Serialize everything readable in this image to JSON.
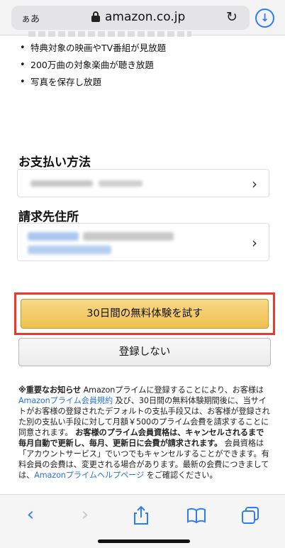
{
  "browser": {
    "aa_label": "ぁあ",
    "domain": "amazon.co.jp",
    "reload_icon": "reload-icon",
    "download_icon": "download-icon"
  },
  "benefits": [
    "特典対象の映画やTV番組が見放題",
    "200万曲の対象楽曲が聴き放題",
    "写真を保存し放題"
  ],
  "payment": {
    "title": "お支払い方法"
  },
  "billing": {
    "title": "請求先住所"
  },
  "actions": {
    "trial_label": "30日間の無料体験を試す",
    "decline_label": "登録しない"
  },
  "notice": {
    "heading": "※重要なお知らせ",
    "p1": " Amazonプライムに登録することにより、お客様は ",
    "link_terms": "Amazonプライム会員規約",
    "p2": " 及び、30日間の無料体験期間後に、当サイトがお客様の登録されたデフォルトの支払手段又は、お客様が登録された別の支払い手段に対して月額￥500のプライム会費を請求することに同意されます。",
    "bold2": " お客様のプライム会員資格は、キャンセルされるまで毎月自動で更新し、毎月、更新日に会費が請求されます。",
    "p3": " 会員資格は「アカウントサービス」でいつでもキャンセルすることができます。有料会員の会費は、変更される場合があります。最新の会費につきましては、",
    "link_help": "Amazonプライムヘルプページ",
    "p4": " をご確認ください。"
  },
  "toolbar": {
    "back_icon": "back-icon",
    "forward_icon": "forward-icon",
    "share_icon": "share-icon",
    "bookmarks_icon": "bookmarks-icon",
    "tabs_icon": "tabs-icon"
  },
  "colors": {
    "accent_blue": "#2f7cf6",
    "highlight_red": "#e8392b",
    "trial_yellow": "#f0c14b",
    "link_blue": "#2b73d1"
  }
}
